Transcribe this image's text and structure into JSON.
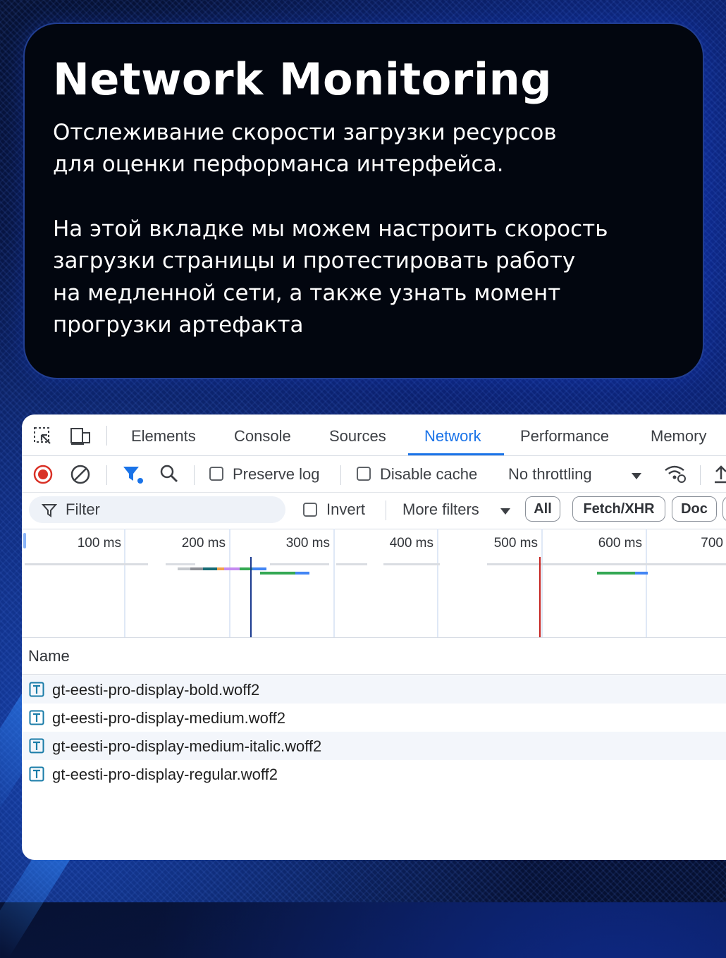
{
  "hero": {
    "title": "Network Monitoring",
    "paragraph1_line1": "Отслеживание скорости загрузки ресурсов",
    "paragraph1_line2": "для оценки перформанса интерфейса.",
    "paragraph2_line1": "На этой вкладке мы можем настроить скорость",
    "paragraph2_line2": "загрузки страницы и протестировать работу",
    "paragraph2_line3": "на медленной сети, а также узнать момент",
    "paragraph2_line4": "прогрузки артефакта"
  },
  "devtools": {
    "tabs": [
      {
        "label": "Elements"
      },
      {
        "label": "Console"
      },
      {
        "label": "Sources"
      },
      {
        "label": "Network"
      },
      {
        "label": "Performance"
      },
      {
        "label": "Memory"
      }
    ],
    "active_tab": "Network",
    "toolbar": {
      "preserve_log_label": "Preserve log",
      "preserve_log_checked": false,
      "disable_cache_label": "Disable cache",
      "disable_cache_checked": false,
      "throttling_value": "No throttling"
    },
    "filter": {
      "placeholder": "Filter",
      "invert_label": "Invert",
      "invert_checked": false,
      "more_filters_label": "More filters",
      "type_buttons": [
        "All",
        "Fetch/XHR",
        "Doc"
      ]
    },
    "timeline": {
      "ticks": [
        "100 ms",
        "200 ms",
        "300 ms",
        "400 ms",
        "500 ms",
        "600 ms",
        "700"
      ],
      "dom_content_loaded_ms": 220,
      "load_ms": 494
    },
    "table": {
      "header_name": "Name",
      "rows": [
        {
          "name": "gt-eesti-pro-display-bold.woff2"
        },
        {
          "name": "gt-eesti-pro-display-medium.woff2"
        },
        {
          "name": "gt-eesti-pro-display-medium-italic.woff2"
        },
        {
          "name": "gt-eesti-pro-display-regular.woff2"
        }
      ]
    },
    "colors": {
      "accent": "#1a73e8",
      "record_red": "#d93025",
      "dcl_line": "#1a3a8f",
      "load_line": "#c5221f"
    }
  }
}
